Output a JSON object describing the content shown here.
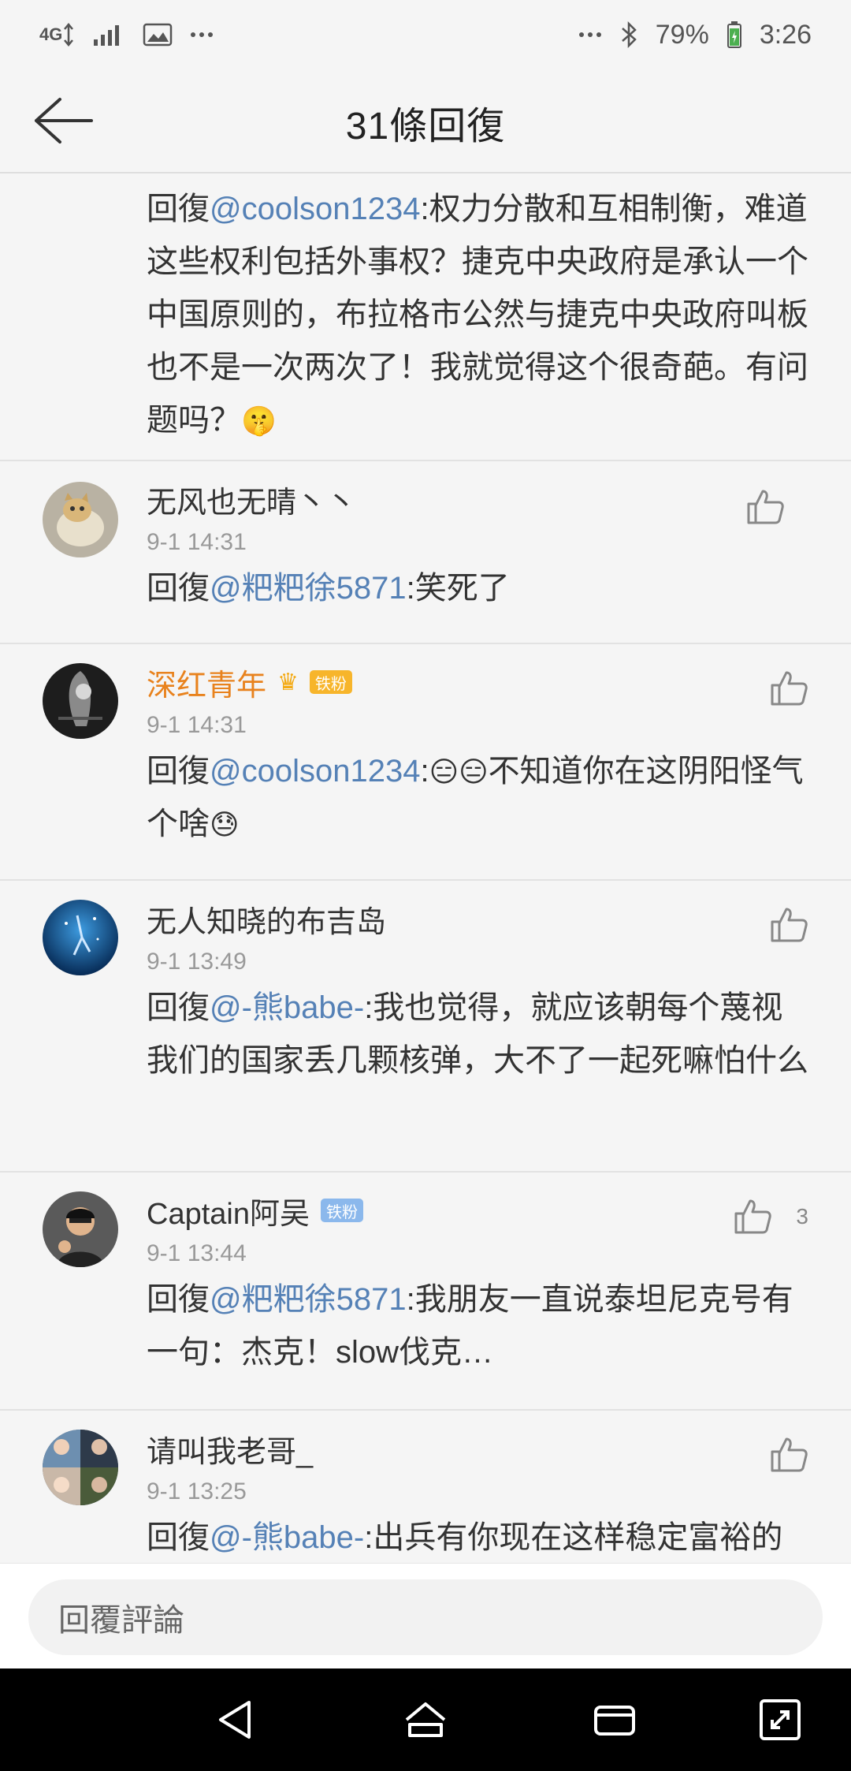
{
  "status_bar": {
    "network": "4G",
    "icons": [
      "signal-icon",
      "image-icon",
      "more-icon"
    ],
    "battery_pct": "79%",
    "time": "3:26"
  },
  "header": {
    "title": "31條回復"
  },
  "top_reply": {
    "prefix": "回復",
    "mention": "@coolson1234",
    "text": ":权力分散和互相制衡，难道这些权利包括外事权？捷克中央政府是承认一个中国原则的，布拉格市公然与捷克中央政府叫板也不是一次两次了！我就觉得这个很奇葩。有问题吗？",
    "emoji": "🤫"
  },
  "comments": [
    {
      "username": "无风也无晴丶丶",
      "time": "9-1 14:31",
      "prefix": "回復",
      "mention": "@粑粑徐5871",
      "text": ":笑死了",
      "emoji_tail": "",
      "like_count": ""
    },
    {
      "username": "深红青年",
      "badge": "铁粉",
      "time": "9-1 14:31",
      "prefix": "回復",
      "mention": "@coolson1234",
      "text_a": ":",
      "emoji_a": "😑😑",
      "text_b": "不知道你在这阴阳怪气个啥",
      "emoji_b": "😓"
    },
    {
      "username": "无人知晓的布吉岛",
      "time": "9-1 13:49",
      "prefix": "回復",
      "mention": "@-熊babe-",
      "text": ":我也觉得，就应该朝每个蔑视我们的国家丢几颗核弹，大不了一起死嘛怕什么"
    },
    {
      "username": "Captain阿吴",
      "badge": "铁粉",
      "time": "9-1 13:44",
      "prefix": "回復",
      "mention": "@粑粑徐5871",
      "text": ":我朋友一直说泰坦尼克号有一句：杰克！slow伐克…",
      "like_count": "3"
    },
    {
      "username": "请叫我老哥_",
      "time": "9-1 13:25",
      "prefix": "回復",
      "mention": "@-熊babe-",
      "text": ":出兵有你现在这样稳定富裕的"
    }
  ],
  "input": {
    "placeholder": "回覆評論"
  },
  "colors": {
    "mention": "#5581b6",
    "vip_name": "#e8821d",
    "badge": "#8bb8ec"
  }
}
